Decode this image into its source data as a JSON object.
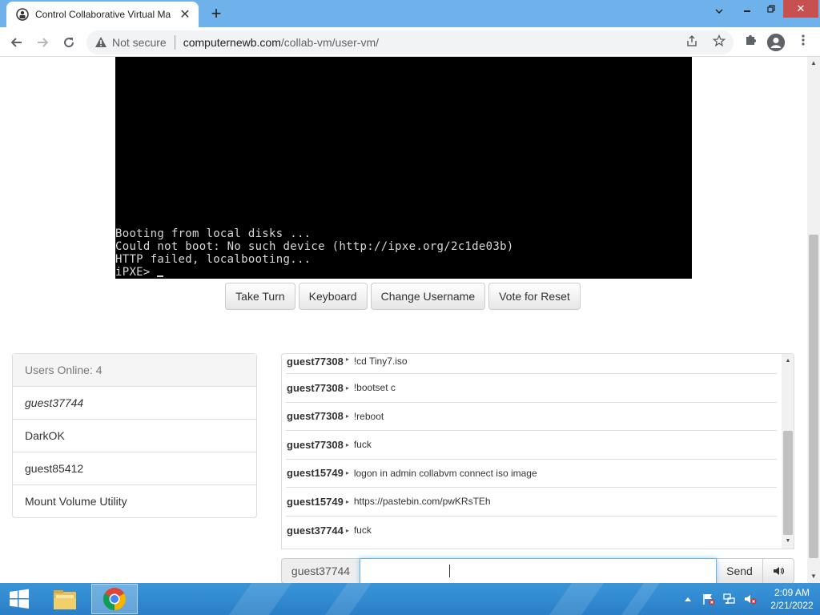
{
  "browser": {
    "tab_title": "Control Collaborative Virtual Ma",
    "tab_close": "✕",
    "new_tab": "+",
    "security_label": "Not secure",
    "url_host": "computernewb.com",
    "url_path": "/collab-vm/user-vm/",
    "window_min": "⌄",
    "window_restore": "❐",
    "window_close": "✕"
  },
  "vm": {
    "console_lines": [
      "Booting from local disks ...",
      "Could not boot: No such device (http://ipxe.org/2c1de03b)",
      "HTTP failed, localbooting...",
      "iPXE> "
    ],
    "buttons": {
      "take_turn": "Take Turn",
      "keyboard": "Keyboard",
      "change_username": "Change Username",
      "vote_reset": "Vote for Reset"
    }
  },
  "users": {
    "header": "Users Online: 4",
    "list": [
      "guest37744",
      "DarkOK",
      "guest85412",
      "Mount Volume Utility"
    ]
  },
  "chat": {
    "separator": "▸",
    "messages": [
      {
        "user": "guest77308",
        "text": "!cd Tiny7.iso"
      },
      {
        "user": "guest77308",
        "text": "!bootset c"
      },
      {
        "user": "guest77308",
        "text": "!reboot"
      },
      {
        "user": "guest77308",
        "text": "fuck"
      },
      {
        "user": "guest15749",
        "text": "logon in admin collabvm connect iso image"
      },
      {
        "user": "guest15749",
        "text": "https://pastebin.com/pwKRsTEh"
      },
      {
        "user": "guest37744",
        "text": "fuck"
      }
    ],
    "input_username": "guest37744",
    "input_value": "",
    "send_label": "Send"
  },
  "taskbar": {
    "time": "2:09 AM",
    "date": "2/21/2022"
  },
  "colors": {
    "tabbar": "#6fb1ea",
    "taskbar": "#2a7fc7",
    "close_button": "#c75050",
    "vm_background": "#000000"
  }
}
